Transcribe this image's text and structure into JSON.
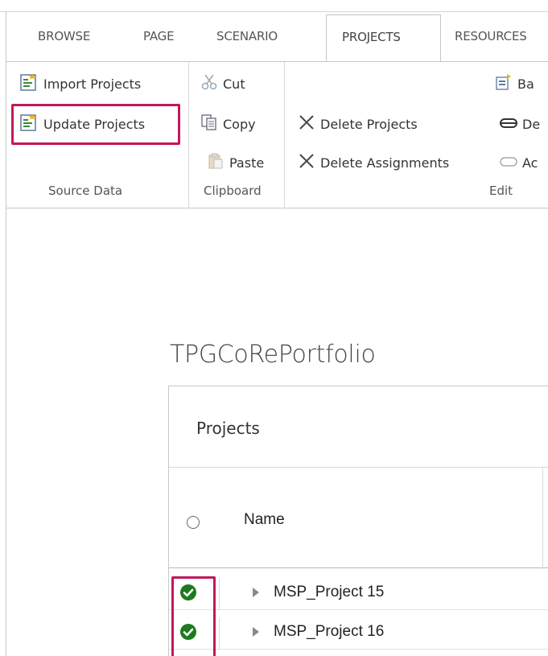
{
  "tabs": [
    {
      "label": "BROWSE"
    },
    {
      "label": "PAGE"
    },
    {
      "label": "SCENARIO"
    },
    {
      "label": "PROJECTS",
      "active": true
    },
    {
      "label": "RESOURCES"
    }
  ],
  "ribbon": {
    "source_data": {
      "label": "Source Data",
      "import": "Import Projects",
      "update": "Update Projects"
    },
    "clipboard": {
      "label": "Clipboard",
      "cut": "Cut",
      "copy": "Copy",
      "paste": "Paste"
    },
    "edit": {
      "label": "Edit",
      "delete_projects": "Delete Projects",
      "delete_assignments": "Delete Assignments",
      "cut_off_1": "Ba",
      "cut_off_2": "De",
      "cut_off_3": "Ac"
    }
  },
  "page": {
    "portfolio_title": "TPGCoRePortfolio"
  },
  "grid": {
    "title": "Projects",
    "column_name": "Name",
    "rows": [
      {
        "name": "MSP_Project 15",
        "status": "checked"
      },
      {
        "name": "MSP_Project 16",
        "status": "checked"
      }
    ]
  },
  "colors": {
    "highlight": "#c2185b",
    "check_green": "#1f7a1f"
  }
}
